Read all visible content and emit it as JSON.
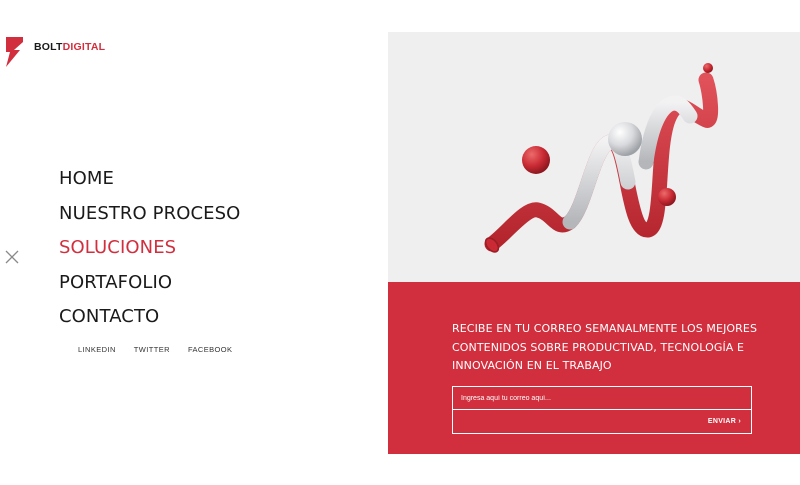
{
  "brand": {
    "name_part1": "BOLT",
    "name_part2": "DIGITAL"
  },
  "nav": {
    "items": [
      {
        "label": "HOME"
      },
      {
        "label": "NUESTRO PROCESO"
      },
      {
        "label": "SOLUCIONES",
        "active": true
      },
      {
        "label": "PORTAFOLIO"
      },
      {
        "label": "CONTACTO"
      }
    ]
  },
  "social": [
    {
      "label": "LINKEDIN"
    },
    {
      "label": "TWITTER"
    },
    {
      "label": "FACEBOOK"
    }
  ],
  "newsletter": {
    "headline_lines": [
      "RECIBE EN TU CORREO SEMANALMENTE LOS MEJORES",
      "CONTENIDOS SOBRE PRODUCTIVAD, TECNOLOGÍA E",
      "INNOVACIÓN EN EL TRABAJO"
    ],
    "email_placeholder": "Ingresa aquí tu correo aquí...",
    "submit_label": "ENVIAR ›"
  },
  "colors": {
    "accent": "#d22f3e",
    "hero_bg": "#efeff0",
    "text": "#1a1a1a"
  },
  "icons": {
    "close": "close-icon",
    "logo": "bolt-logo-icon"
  }
}
